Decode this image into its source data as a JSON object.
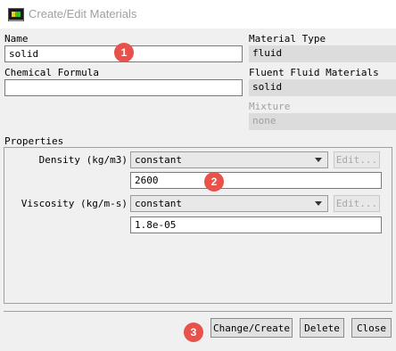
{
  "window": {
    "title": "Create/Edit Materials",
    "icon": "fluent-app-icon"
  },
  "name": {
    "label": "Name",
    "value": "solid"
  },
  "chemical_formula": {
    "label": "Chemical Formula",
    "value": ""
  },
  "material_type": {
    "label": "Material Type",
    "value": "fluid"
  },
  "fluent_fluid_materials": {
    "label": "Fluent Fluid Materials",
    "value": "solid"
  },
  "mixture": {
    "label": "Mixture",
    "value": "none"
  },
  "properties": {
    "title": "Properties",
    "density": {
      "label": "Density (kg/m3)",
      "method": "constant",
      "edit_label": "Edit...",
      "value": "2600"
    },
    "viscosity": {
      "label": "Viscosity (kg/m-s)",
      "method": "constant",
      "edit_label": "Edit...",
      "value": "1.8e-05"
    }
  },
  "buttons": {
    "change_create": "Change/Create",
    "delete": "Delete",
    "close": "Close"
  },
  "annotations": {
    "one": "1",
    "two": "2",
    "three": "3"
  },
  "colors": {
    "annotation": "#e8524a",
    "readonly_bg": "#dcdcdc"
  }
}
